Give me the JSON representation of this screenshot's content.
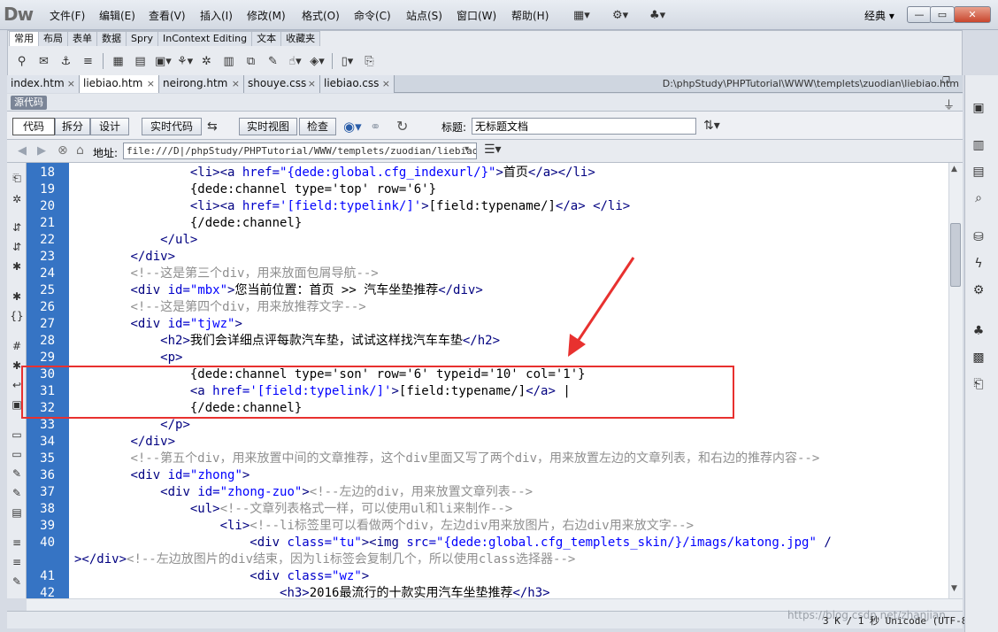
{
  "app": {
    "logo": "Dw",
    "menus": [
      "文件(F)",
      "编辑(E)",
      "查看(V)",
      "插入(I)",
      "修改(M)",
      "格式(O)",
      "命令(C)",
      "站点(S)",
      "窗口(W)",
      "帮助(H)"
    ],
    "layout_label": "经典",
    "window_buttons": [
      "—",
      "▭",
      "✕"
    ]
  },
  "insert_bar": {
    "tabs": [
      "常用",
      "布局",
      "表单",
      "数据",
      "Spry",
      "InContext Editing",
      "文本",
      "收藏夹"
    ],
    "active_tab": "常用"
  },
  "doc_tabs": [
    {
      "label": "index.htm",
      "active": false
    },
    {
      "label": "liebiao.htm",
      "active": true
    },
    {
      "label": "neirong.htm",
      "active": false
    },
    {
      "label": "shouye.css",
      "active": false
    },
    {
      "label": "liebiao.css",
      "active": false
    }
  ],
  "doc_path": "D:\\phpStudy\\PHPTutorial\\WWW\\templets\\zuodian\\liebiao.htm",
  "source_badge": "源代码",
  "view_buttons": {
    "code": "代码",
    "split": "拆分",
    "design": "设计",
    "live_code": "实时代码",
    "live_view": "实时视图",
    "inspect": "检查"
  },
  "title_field": {
    "label": "标题:",
    "value": "无标题文档"
  },
  "address": {
    "label": "地址:",
    "value": "file:///D|/phpStudy/PHPTutorial/WWW/templets/zuodian/liebiao.htm"
  },
  "status_bar": {
    "text": "3 K / 1 秒 Unicode (UTF-8)",
    "watermark": "https://blog.csdn.net/zhanjian"
  },
  "code_lines": [
    {
      "n": "18",
      "segs": [
        [
          "",
          "                "
        ],
        [
          "tg",
          "<li><a "
        ],
        [
          "at",
          "href="
        ],
        [
          "st",
          "\"{dede:global.cfg_indexurl/}\""
        ],
        [
          "tg",
          ">"
        ],
        [
          "",
          "首页"
        ],
        [
          "tg",
          "</a></li>"
        ]
      ]
    },
    {
      "n": "19",
      "segs": [
        [
          "",
          "                {dede:channel type='top' row='6'}"
        ]
      ]
    },
    {
      "n": "20",
      "segs": [
        [
          "",
          "                "
        ],
        [
          "tg",
          "<li><a "
        ],
        [
          "at",
          "href="
        ],
        [
          "st",
          "'[field:typelink/]'"
        ],
        [
          "tg",
          ">"
        ],
        [
          "",
          "[field:typename/]"
        ],
        [
          "tg",
          "</a> </li>"
        ]
      ]
    },
    {
      "n": "21",
      "segs": [
        [
          "",
          "                {/dede:channel}"
        ]
      ]
    },
    {
      "n": "22",
      "segs": [
        [
          "",
          "            "
        ],
        [
          "tg",
          "</ul>"
        ]
      ]
    },
    {
      "n": "23",
      "segs": [
        [
          "",
          "        "
        ],
        [
          "tg",
          "</div>"
        ]
      ]
    },
    {
      "n": "24",
      "segs": [
        [
          "",
          "        "
        ],
        [
          "cm",
          "<!--这是第三个div，用来放面包屑导航-->"
        ]
      ]
    },
    {
      "n": "25",
      "segs": [
        [
          "",
          "        "
        ],
        [
          "tg",
          "<div "
        ],
        [
          "at",
          "id="
        ],
        [
          "st",
          "\"mbx\""
        ],
        [
          "tg",
          ">"
        ],
        [
          "",
          "您当前位置：首页 >> 汽车坐垫推荐"
        ],
        [
          "tg",
          "</div>"
        ]
      ]
    },
    {
      "n": "26",
      "segs": [
        [
          "",
          "        "
        ],
        [
          "cm",
          "<!--这是第四个div，用来放推荐文字-->"
        ]
      ]
    },
    {
      "n": "27",
      "segs": [
        [
          "",
          "        "
        ],
        [
          "tg",
          "<div "
        ],
        [
          "at",
          "id="
        ],
        [
          "st",
          "\"tjwz\""
        ],
        [
          "tg",
          ">"
        ]
      ]
    },
    {
      "n": "28",
      "segs": [
        [
          "",
          "            "
        ],
        [
          "tg",
          "<h2>"
        ],
        [
          "",
          "我们会详细点评每款汽车垫，试试这样找汽车车垫"
        ],
        [
          "tg",
          "</h2>"
        ]
      ]
    },
    {
      "n": "29",
      "segs": [
        [
          "",
          "            "
        ],
        [
          "tg",
          "<p>"
        ]
      ]
    },
    {
      "n": "30",
      "segs": [
        [
          "",
          "                {dede:channel type='son' row='6' typeid='10' col='1'}"
        ]
      ]
    },
    {
      "n": "31",
      "segs": [
        [
          "",
          "                "
        ],
        [
          "tg",
          "<a "
        ],
        [
          "at",
          "href="
        ],
        [
          "st",
          "'[field:typelink/]'"
        ],
        [
          "tg",
          ">"
        ],
        [
          "",
          "[field:typename/]"
        ],
        [
          "tg",
          "</a>"
        ],
        [
          "",
          " |"
        ]
      ]
    },
    {
      "n": "32",
      "segs": [
        [
          "",
          "                {/dede:channel}"
        ]
      ]
    },
    {
      "n": "33",
      "segs": [
        [
          "",
          "            "
        ],
        [
          "tg",
          "</p>"
        ]
      ]
    },
    {
      "n": "34",
      "segs": [
        [
          "",
          "        "
        ],
        [
          "tg",
          "</div>"
        ]
      ]
    },
    {
      "n": "35",
      "segs": [
        [
          "",
          "        "
        ],
        [
          "cm",
          "<!--第五个div，用来放置中间的文章推荐，这个div里面又写了两个div，用来放置左边的文章列表，和右边的推荐内容-->"
        ]
      ]
    },
    {
      "n": "36",
      "segs": [
        [
          "",
          "        "
        ],
        [
          "tg",
          "<div "
        ],
        [
          "at",
          "id="
        ],
        [
          "st",
          "\"zhong\""
        ],
        [
          "tg",
          ">"
        ]
      ]
    },
    {
      "n": "37",
      "segs": [
        [
          "",
          "            "
        ],
        [
          "tg",
          "<div "
        ],
        [
          "at",
          "id="
        ],
        [
          "st",
          "\"zhong-zuo\""
        ],
        [
          "tg",
          ">"
        ],
        [
          "cm",
          "<!--左边的div，用来放置文章列表-->"
        ]
      ]
    },
    {
      "n": "38",
      "segs": [
        [
          "",
          "                "
        ],
        [
          "tg",
          "<ul>"
        ],
        [
          "cm",
          "<!--文章列表格式一样，可以使用ul和li来制作-->"
        ]
      ]
    },
    {
      "n": "39",
      "segs": [
        [
          "",
          "                    "
        ],
        [
          "tg",
          "<li>"
        ],
        [
          "cm",
          "<!--li标签里可以看做两个div，左边div用来放图片，右边div用来放文字-->"
        ]
      ]
    },
    {
      "n": "40",
      "segs": [
        [
          "",
          "                        "
        ],
        [
          "tg",
          "<div "
        ],
        [
          "at",
          "class="
        ],
        [
          "st",
          "\"tu\""
        ],
        [
          "tg",
          "><img "
        ],
        [
          "at",
          "src="
        ],
        [
          "st",
          "\"{dede:global.cfg_templets_skin/}/imags/katong.jpg\""
        ],
        [
          "tg",
          " /"
        ]
      ]
    },
    {
      "n": "",
      "segs": [
        [
          "tg",
          "></div>"
        ],
        [
          "cm",
          "<!--左边放图片的div结束，因为li标签会复制几个，所以使用class选择器-->"
        ]
      ]
    },
    {
      "n": "41",
      "segs": [
        [
          "",
          "                        "
        ],
        [
          "tg",
          "<div "
        ],
        [
          "at",
          "class="
        ],
        [
          "st",
          "\"wz\""
        ],
        [
          "tg",
          ">"
        ]
      ]
    },
    {
      "n": "42",
      "segs": [
        [
          "",
          "                            "
        ],
        [
          "tg",
          "<h3>"
        ],
        [
          "",
          "2016最流行的十款实用汽车坐垫推荐"
        ],
        [
          "tg",
          "</h3>"
        ]
      ]
    }
  ]
}
